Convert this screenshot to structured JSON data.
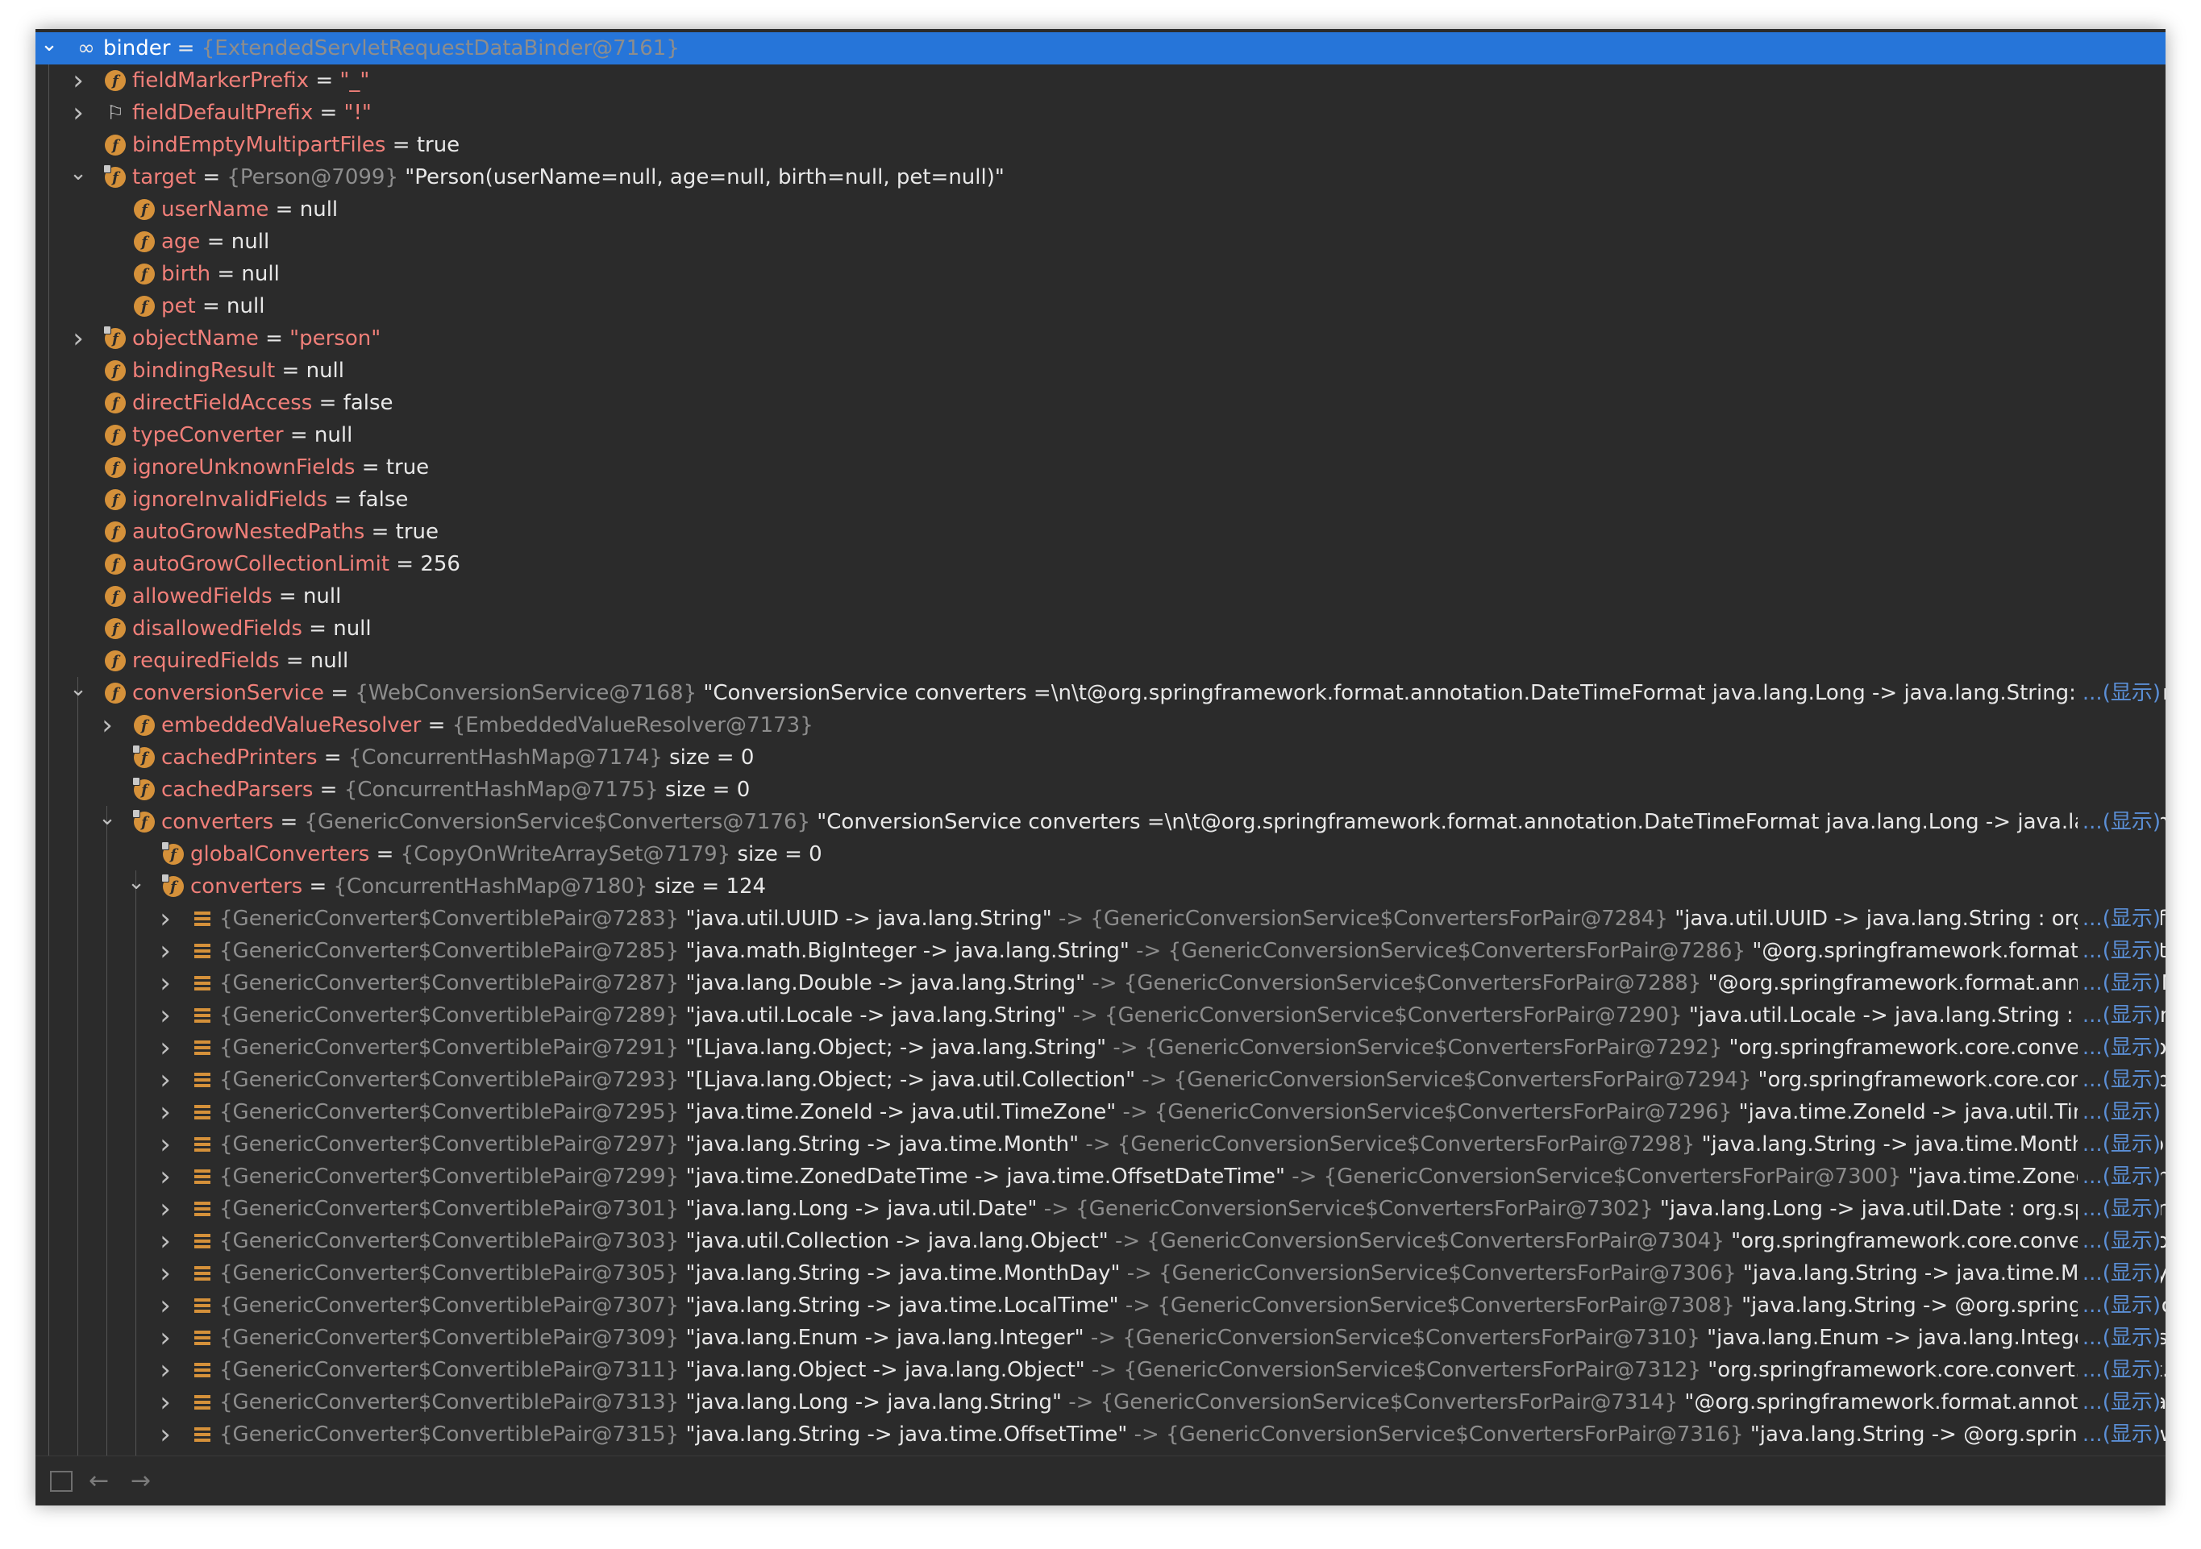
{
  "tree": {
    "rows": [
      {
        "toggle": "open",
        "icon": "object",
        "name": "binder",
        "eq": " = ",
        "type": "{ExtendedServletRequestDataBinder@7161}",
        "value": "",
        "selected": true
      },
      {
        "toggle": "closed",
        "icon": "field",
        "name": "fieldMarkerPrefix",
        "eq": " = ",
        "type": "",
        "value": "",
        "str": "\"_\""
      },
      {
        "toggle": "closed",
        "icon": "flag",
        "name": "fieldDefaultPrefix",
        "eq": " = ",
        "type": "",
        "value": "",
        "str": "\"!\""
      },
      {
        "icon": "field",
        "name": "bindEmptyMultipartFiles",
        "eq": " = ",
        "value": "true"
      },
      {
        "toggle": "open",
        "icon": "field-locked",
        "name": "target",
        "eq": " = ",
        "type": "{Person@7099} ",
        "value": "\"Person(userName=null, age=null, birth=null, pet=null)\""
      },
      {
        "icon": "field",
        "name": "userName",
        "eq": " = ",
        "value": "null"
      },
      {
        "icon": "field",
        "name": "age",
        "eq": " = ",
        "value": "null"
      },
      {
        "icon": "field",
        "name": "birth",
        "eq": " = ",
        "value": "null"
      },
      {
        "icon": "field",
        "name": "pet",
        "eq": " = ",
        "value": "null"
      },
      {
        "toggle": "closed",
        "icon": "field-locked",
        "name": "objectName",
        "eq": " = ",
        "value": "",
        "str": "\"person\""
      },
      {
        "icon": "field",
        "name": "bindingResult",
        "eq": " = ",
        "value": "null"
      },
      {
        "icon": "field",
        "name": "directFieldAccess",
        "eq": " = ",
        "value": "false"
      },
      {
        "icon": "field",
        "name": "typeConverter",
        "eq": " = ",
        "value": "null"
      },
      {
        "icon": "field",
        "name": "ignoreUnknownFields",
        "eq": " = ",
        "value": "true"
      },
      {
        "icon": "field",
        "name": "ignoreInvalidFields",
        "eq": " = ",
        "value": "false"
      },
      {
        "icon": "field",
        "name": "autoGrowNestedPaths",
        "eq": " = ",
        "value": "true"
      },
      {
        "icon": "field",
        "name": "autoGrowCollectionLimit",
        "eq": " = ",
        "value": "256"
      },
      {
        "icon": "field",
        "name": "allowedFields",
        "eq": " = ",
        "value": "null"
      },
      {
        "icon": "field",
        "name": "disallowedFields",
        "eq": " = ",
        "value": "null"
      },
      {
        "icon": "field",
        "name": "requiredFields",
        "eq": " = ",
        "value": "null"
      },
      {
        "toggle": "open",
        "icon": "field",
        "name": "conversionService",
        "eq": " = ",
        "type": "{WebConversionService@7168} ",
        "value": "\"ConversionService converters =\\n\\t@org.springframework.format.annotation.DateTimeFormat java.lang.Long -> java.lang.String: org.springf",
        "show": "...(显示)"
      },
      {
        "toggle": "closed",
        "icon": "field",
        "name": "embeddedValueResolver",
        "eq": " = ",
        "type": "{EmbeddedValueResolver@7173}",
        "value": ""
      },
      {
        "icon": "field-locked",
        "name": "cachedPrinters",
        "eq": " = ",
        "type": "{ConcurrentHashMap@7174} ",
        "value": " size = 0"
      },
      {
        "icon": "field-locked",
        "name": "cachedParsers",
        "eq": " = ",
        "type": "{ConcurrentHashMap@7175} ",
        "value": " size = 0"
      },
      {
        "toggle": "open",
        "icon": "field-locked",
        "name": "converters",
        "eq": " = ",
        "type": "{GenericConversionService$Converters@7176} ",
        "value": "\"ConversionService converters =\\n\\t@org.springframework.format.annotation.DateTimeFormat java.lang.Long -> java.lang.String: o",
        "show": "...(显示)"
      },
      {
        "icon": "field-locked",
        "name": "globalConverters",
        "eq": " = ",
        "type": "{CopyOnWriteArraySet@7179} ",
        "value": " size = 0"
      },
      {
        "toggle": "open",
        "icon": "field-locked",
        "name": "converters",
        "eq": " = ",
        "type": "{ConcurrentHashMap@7180} ",
        "value": " size = 124"
      },
      {
        "toggle": "closed",
        "icon": "list",
        "name": "",
        "type": "{GenericConverter$ConvertiblePair@7283} ",
        "value": "\"java.util.UUID -> java.lang.String\" ",
        "type2": "-> {GenericConversionService$ConvertersForPair@7284} ",
        "value2": "\"java.util.UUID -> java.lang.String : org.springfra",
        "show": "...(显示)"
      },
      {
        "toggle": "closed",
        "icon": "list",
        "name": "",
        "type": "{GenericConverter$ConvertiblePair@7285} ",
        "value": "\"java.math.BigInteger -> java.lang.String\" ",
        "type2": "-> {GenericConversionService$ConvertersForPair@7286} ",
        "value2": "\"@org.springframework.format.annotatio",
        "show": "...(显示)"
      },
      {
        "toggle": "closed",
        "icon": "list",
        "name": "",
        "type": "{GenericConverter$ConvertiblePair@7287} ",
        "value": "\"java.lang.Double -> java.lang.String\" ",
        "type2": "-> {GenericConversionService$ConvertersForPair@7288} ",
        "value2": "\"@org.springframework.format.annotation.Nu",
        "show": "...(显示)"
      },
      {
        "toggle": "closed",
        "icon": "list",
        "name": "",
        "type": "{GenericConverter$ConvertiblePair@7289} ",
        "value": "\"java.util.Locale -> java.lang.String\" ",
        "type2": "-> {GenericConversionService$ConvertersForPair@7290} ",
        "value2": "\"java.util.Locale -> java.lang.String : org.spring",
        "show": "...(显示)"
      },
      {
        "toggle": "closed",
        "icon": "list",
        "name": "",
        "type": "{GenericConverter$ConvertiblePair@7291} ",
        "value": "\"[Ljava.lang.Object; -> java.lang.String\" ",
        "type2": "-> {GenericConversionService$ConvertersForPair@7292} ",
        "value2": "\"org.springframework.core.convert.support.",
        "show": "...(显示)"
      },
      {
        "toggle": "closed",
        "icon": "list",
        "name": "",
        "type": "{GenericConverter$ConvertiblePair@7293} ",
        "value": "\"[Ljava.lang.Object; -> java.util.Collection\" ",
        "type2": "-> {GenericConversionService$ConvertersForPair@7294} ",
        "value2": "\"org.springframework.core.convert.supp",
        "show": "...(显示)"
      },
      {
        "toggle": "closed",
        "icon": "list",
        "name": "",
        "type": "{GenericConverter$ConvertiblePair@7295} ",
        "value": "\"java.time.ZoneId -> java.util.TimeZone\" ",
        "type2": "-> {GenericConversionService$ConvertersForPair@7296} ",
        "value2": "\"java.time.ZoneId -> java.util.TimeZone : or",
        "show": "...(显示)"
      },
      {
        "toggle": "closed",
        "icon": "list",
        "name": "",
        "type": "{GenericConverter$ConvertiblePair@7297} ",
        "value": "\"java.lang.String -> java.time.Month\" ",
        "type2": "-> {GenericConversionService$ConvertersForPair@7298} ",
        "value2": "\"java.lang.String -> java.time.Month: org.sprin",
        "show": "...(显示)"
      },
      {
        "toggle": "closed",
        "icon": "list",
        "name": "",
        "type": "{GenericConverter$ConvertiblePair@7299} ",
        "value": "\"java.time.ZonedDateTime -> java.time.OffsetDateTime\" ",
        "type2": "-> {GenericConversionService$ConvertersForPair@7300} ",
        "value2": "\"java.time.ZonedDateTime -",
        "show": "...(显示)"
      },
      {
        "toggle": "closed",
        "icon": "list",
        "name": "",
        "type": "{GenericConverter$ConvertiblePair@7301} ",
        "value": "\"java.lang.Long -> java.util.Date\" ",
        "type2": "-> {GenericConversionService$ConvertersForPair@7302} ",
        "value2": "\"java.lang.Long -> java.util.Date : org.springframew",
        "show": "...(显示)"
      },
      {
        "toggle": "closed",
        "icon": "list",
        "name": "",
        "type": "{GenericConverter$ConvertiblePair@7303} ",
        "value": "\"java.util.Collection -> java.lang.Object\" ",
        "type2": "-> {GenericConversionService$ConvertersForPair@7304} ",
        "value2": "\"org.springframework.core.convert.support",
        "show": "...(显示)"
      },
      {
        "toggle": "closed",
        "icon": "list",
        "name": "",
        "type": "{GenericConverter$ConvertiblePair@7305} ",
        "value": "\"java.lang.String -> java.time.MonthDay\" ",
        "type2": "-> {GenericConversionService$ConvertersForPair@7306} ",
        "value2": "\"java.lang.String -> java.time.MonthDay: o",
        "show": "...(显示)"
      },
      {
        "toggle": "closed",
        "icon": "list",
        "name": "",
        "type": "{GenericConverter$ConvertiblePair@7307} ",
        "value": "\"java.lang.String -> java.time.LocalTime\" ",
        "type2": "-> {GenericConversionService$ConvertersForPair@7308} ",
        "value2": "\"java.lang.String -> @org.springframework",
        "show": "...(显示)"
      },
      {
        "toggle": "closed",
        "icon": "list",
        "name": "",
        "type": "{GenericConverter$ConvertiblePair@7309} ",
        "value": "\"java.lang.Enum -> java.lang.Integer\" ",
        "type2": "-> {GenericConversionService$ConvertersForPair@7310} ",
        "value2": "\"java.lang.Enum -> java.lang.Integer : org.spri",
        "show": "...(显示)"
      },
      {
        "toggle": "closed",
        "icon": "list",
        "name": "",
        "type": "{GenericConverter$ConvertiblePair@7311} ",
        "value": "\"java.lang.Object -> java.lang.Object\" ",
        "type2": "-> {GenericConversionService$ConvertersForPair@7312} ",
        "value2": "\"org.springframework.core.convert.support.Id",
        "show": "...(显示)"
      },
      {
        "toggle": "closed",
        "icon": "list",
        "name": "",
        "type": "{GenericConverter$ConvertiblePair@7313} ",
        "value": "\"java.lang.Long -> java.lang.String\" ",
        "type2": "-> {GenericConversionService$ConvertersForPair@7314} ",
        "value2": "\"@org.springframework.format.annotation.DateT",
        "show": "...(显示)"
      },
      {
        "toggle": "closed",
        "icon": "list",
        "name": "",
        "type": "{GenericConverter$ConvertiblePair@7315} ",
        "value": "\"java.lang.String -> java.time.OffsetTime\" ",
        "type2": "-> {GenericConversionService$ConvertersForPair@7316} ",
        "value2": "\"java.lang.String -> @org.springframeworl",
        "show": "...(显示)"
      }
    ]
  },
  "footer": {
    "buttons": [
      {
        "icon": "table-view-icon"
      },
      {
        "icon": "arrow-left-icon",
        "glyph": "←"
      },
      {
        "icon": "arrow-right-icon",
        "glyph": "→"
      }
    ]
  },
  "colors": {
    "background": "#2b2b2b",
    "selection": "#2675d9",
    "field_name": "#f07f79",
    "type_gray": "#8d8d8d",
    "value": "#e8e8e8",
    "link": "#5b8fd6",
    "field_icon": "#d5913a"
  }
}
